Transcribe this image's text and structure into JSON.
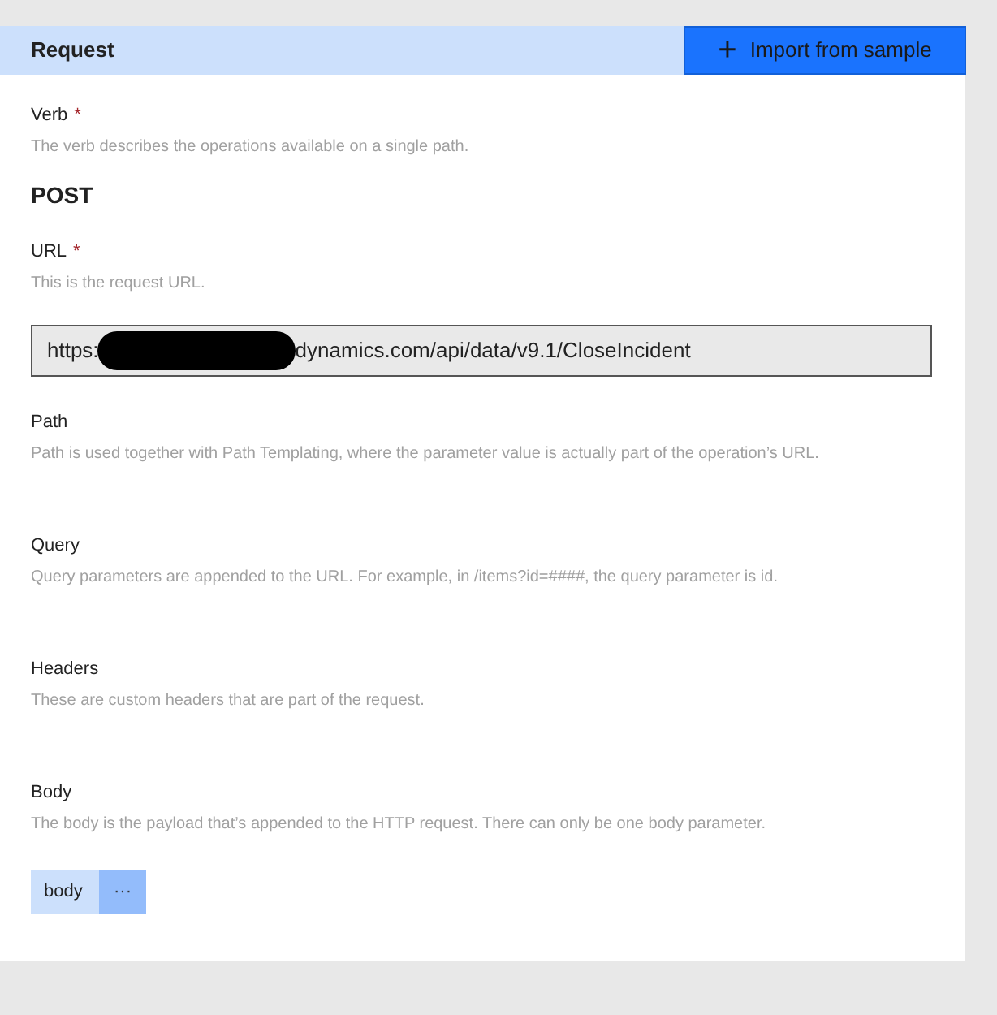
{
  "header": {
    "title": "Request",
    "import_button": {
      "icon": "+",
      "label": "Import from sample"
    }
  },
  "sections": [
    {
      "kind": "text",
      "label": "Verb",
      "required_mark": "*",
      "description": "The verb describes the operations available on a single path.",
      "value": "POST"
    },
    {
      "kind": "url",
      "label": "URL",
      "required_mark": "*",
      "description": "This is the request URL.",
      "value_start": "https:",
      "value_end": "dynamics.com/api/data/v9.1/CloseIncident"
    },
    {
      "kind": "empty",
      "label": "Path",
      "description": "Path is used together with Path Templating, where the parameter value is actually part of the operation’s URL."
    },
    {
      "kind": "empty",
      "label": "Query",
      "description": "Query parameters are appended to the URL. For example, in /items?id=####, the query parameter is id."
    },
    {
      "kind": "empty",
      "label": "Headers",
      "description": "These are custom headers that are part of the request."
    },
    {
      "kind": "chips",
      "label": "Body",
      "description": "The body is the payload that’s appended to the HTTP request. There can only be one body parameter.",
      "chips": [
        {
          "label": "body",
          "more": "···"
        }
      ]
    }
  ]
}
